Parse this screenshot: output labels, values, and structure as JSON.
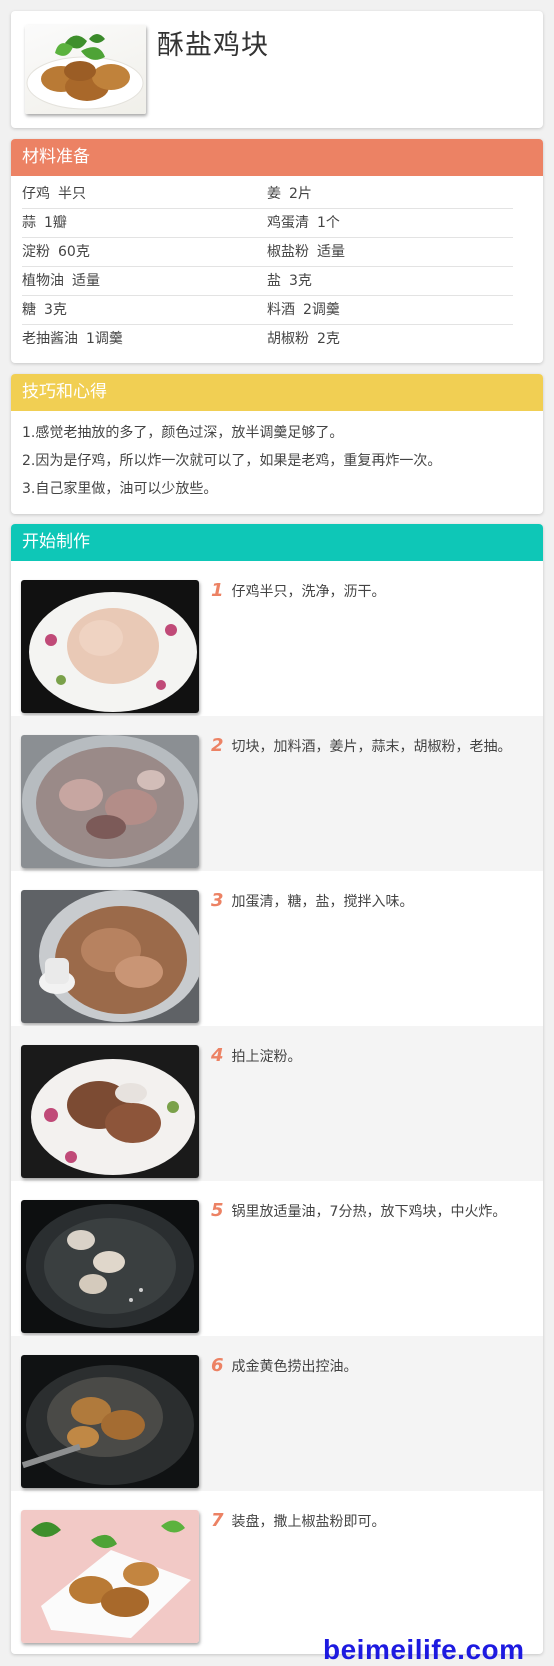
{
  "recipe": {
    "title": "酥盐鸡块"
  },
  "ingredients": {
    "header": "材料准备",
    "rows": [
      [
        {
          "name": "仔鸡",
          "amount": "半只"
        },
        {
          "name": "姜",
          "amount": "2片"
        }
      ],
      [
        {
          "name": "蒜",
          "amount": "1瓣"
        },
        {
          "name": "鸡蛋清",
          "amount": "1个"
        }
      ],
      [
        {
          "name": "淀粉",
          "amount": "60克"
        },
        {
          "name": "椒盐粉",
          "amount": "适量"
        }
      ],
      [
        {
          "name": "植物油",
          "amount": "适量"
        },
        {
          "name": "盐",
          "amount": "3克"
        }
      ],
      [
        {
          "name": "糖",
          "amount": "3克"
        },
        {
          "name": "料酒",
          "amount": "2调羹"
        }
      ],
      [
        {
          "name": "老抽酱油",
          "amount": "1调羹"
        },
        {
          "name": "胡椒粉",
          "amount": "2克"
        }
      ]
    ]
  },
  "tips": {
    "header": "技巧和心得",
    "items": [
      "1.感觉老抽放的多了，颜色过深，放半调羹足够了。",
      "2.因为是仔鸡，所以炸一次就可以了，如果是老鸡，重复再炸一次。",
      "3.自己家里做，油可以少放些。"
    ]
  },
  "steps": {
    "header": "开始制作",
    "items": [
      {
        "num": "1",
        "text": "仔鸡半只，洗净，沥干。"
      },
      {
        "num": "2",
        "text": "切块，加料酒，姜片，蒜末，胡椒粉，老抽。"
      },
      {
        "num": "3",
        "text": "加蛋清，糖，盐，搅拌入味。"
      },
      {
        "num": "4",
        "text": "拍上淀粉。"
      },
      {
        "num": "5",
        "text": "锅里放适量油，7分热，放下鸡块，中火炸。"
      },
      {
        "num": "6",
        "text": "成金黄色捞出控油。"
      },
      {
        "num": "7",
        "text": "装盘，撒上椒盐粉即可。"
      }
    ]
  },
  "watermark": "beimeilife.com"
}
